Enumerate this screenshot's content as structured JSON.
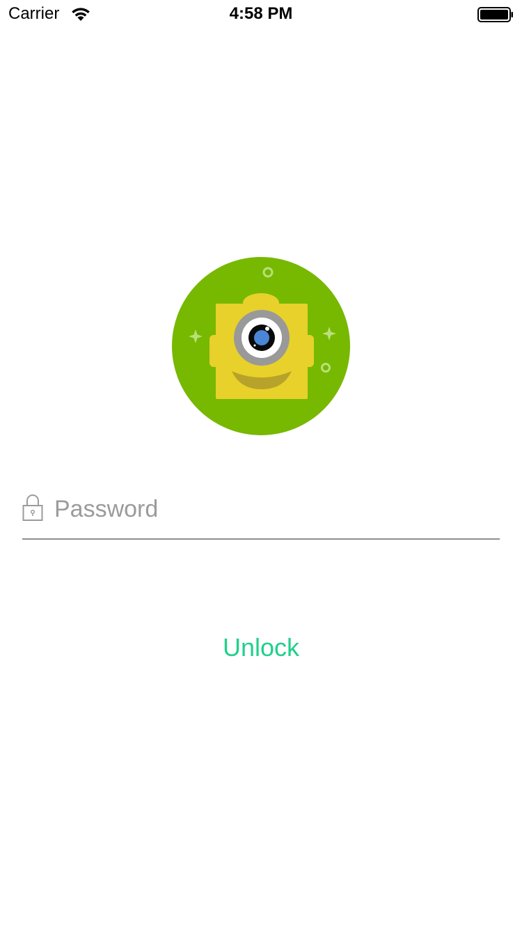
{
  "status_bar": {
    "carrier": "Carrier",
    "time": "4:58 PM",
    "wifi_icon": "wifi-icon",
    "battery_icon": "battery-icon"
  },
  "avatar": {
    "icon": "one-eyed-monster-avatar",
    "colors": {
      "background": "#77b800",
      "body": "#e8d12a",
      "eye_ring": "#999999",
      "iris": "#4a86d8",
      "mouth": "#b8a32a"
    }
  },
  "login": {
    "lock_icon": "lock-icon",
    "password_placeholder": "Password",
    "password_value": "",
    "unlock_label": "Unlock"
  },
  "colors": {
    "accent": "#1fd08a",
    "divider": "#8e8e93",
    "placeholder": "#9b9b9b"
  }
}
